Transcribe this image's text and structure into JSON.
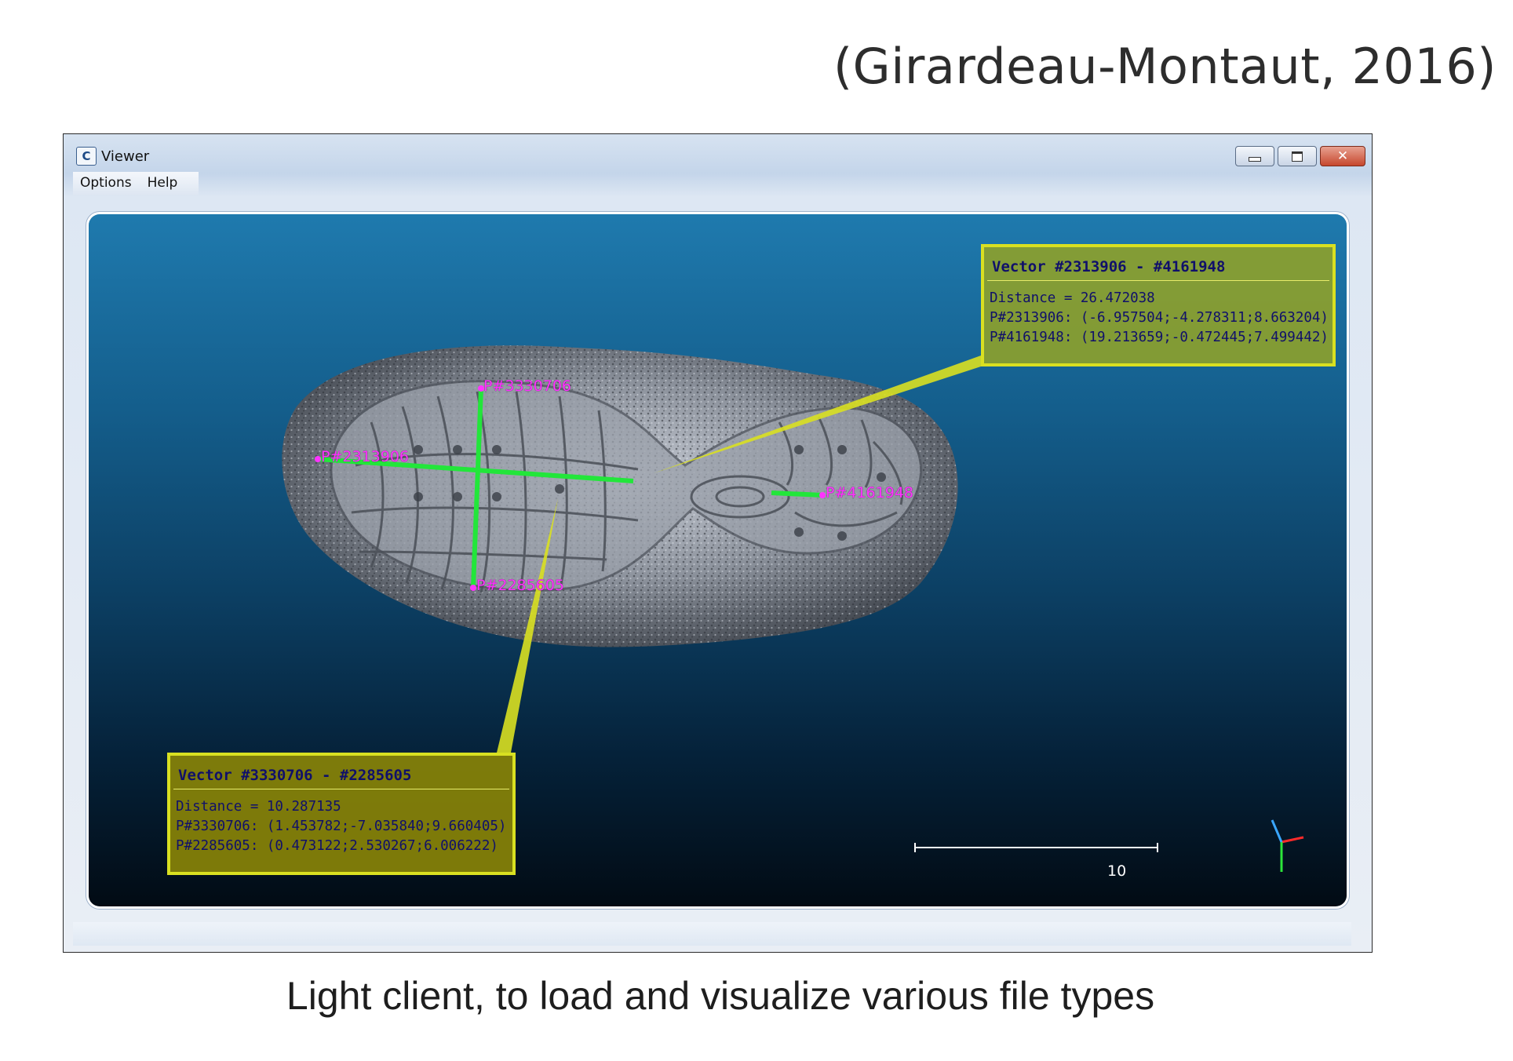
{
  "citation": "(Girardeau-Montaut, 2016)",
  "caption": "Light client, to load and visualize various file types",
  "window": {
    "title": "Viewer",
    "icon": "cloudcompare-app-icon",
    "controls": {
      "minimize": "minimize-icon",
      "maximize": "maximize-icon",
      "close": "close-icon"
    }
  },
  "menu": [
    "Options",
    "Help"
  ],
  "callouts": [
    {
      "title": "Vector #2313906 - #4161948",
      "lines": [
        "Distance = 26.472038",
        "P#2313906: (-6.957504;-4.278311;8.663204)",
        "P#4161948: (19.213659;-0.472445;7.499442)"
      ]
    },
    {
      "title": "Vector #3330706 - #2285605",
      "lines": [
        "Distance = 10.287135",
        "P#3330706: (1.453782;-7.035840;9.660405)",
        "P#2285605: (0.473122;2.530267;6.006222)"
      ]
    }
  ],
  "points": [
    "P#3330706",
    "P#2313906",
    "P#4161948",
    "P#2285605"
  ],
  "scale_bar": {
    "label": "10"
  },
  "colors": {
    "vector_line": "#22e63a",
    "point_label": "#ff33ff",
    "callout_border": "#d9e021",
    "callout_text": "#10106a"
  }
}
